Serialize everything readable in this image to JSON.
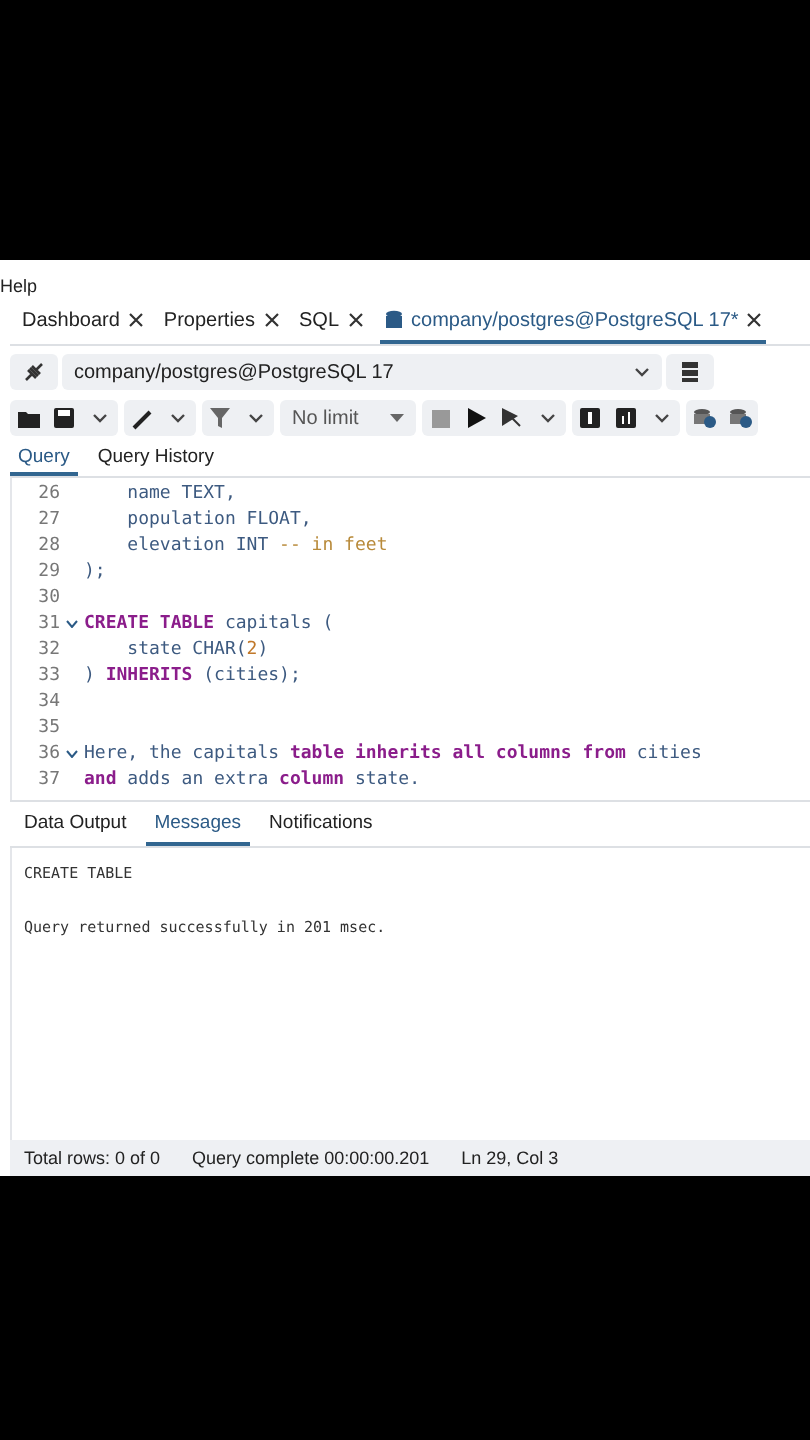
{
  "menu": {
    "items": [
      "Help"
    ]
  },
  "tabs": [
    {
      "label": "Dashboard",
      "selected": false
    },
    {
      "label": "Properties",
      "selected": false
    },
    {
      "label": "SQL",
      "selected": false
    },
    {
      "label": "company/postgres@PostgreSQL 17*",
      "selected": true,
      "kind": "database"
    }
  ],
  "connection": {
    "value": "company/postgres@PostgreSQL 17"
  },
  "toolbar": {
    "limit": "No limit"
  },
  "editor_tabs": [
    {
      "label": "Query",
      "selected": true
    },
    {
      "label": "Query History",
      "selected": false
    }
  ],
  "code_lines": [
    {
      "number": "26",
      "fold": false,
      "tokens": [
        {
          "kind": "plain",
          "text": "    name "
        },
        {
          "kind": "type",
          "text": "TEXT,"
        }
      ]
    },
    {
      "number": "27",
      "fold": false,
      "tokens": [
        {
          "kind": "plain",
          "text": "    population "
        },
        {
          "kind": "type",
          "text": "FLOAT,"
        }
      ]
    },
    {
      "number": "28",
      "fold": false,
      "tokens": [
        {
          "kind": "plain",
          "text": "    elevation "
        },
        {
          "kind": "type",
          "text": "INT "
        },
        {
          "kind": "comment",
          "text": "-- in feet"
        }
      ]
    },
    {
      "number": "29",
      "fold": false,
      "tokens": [
        {
          "kind": "plain",
          "text": ");"
        }
      ]
    },
    {
      "number": "30",
      "fold": false
    },
    {
      "number": "31",
      "fold": true,
      "tokens": [
        {
          "kind": "keyword",
          "text": "CREATE TABLE"
        },
        {
          "kind": "plain",
          "text": " capitals ("
        }
      ]
    },
    {
      "number": "32",
      "fold": false,
      "tokens": [
        {
          "kind": "plain",
          "text": "    state CHAR("
        },
        {
          "kind": "number",
          "text": "2"
        },
        {
          "kind": "plain",
          "text": ")"
        }
      ]
    },
    {
      "number": "33",
      "fold": false,
      "tokens": [
        {
          "kind": "plain",
          "text": ") "
        },
        {
          "kind": "keyword",
          "text": "INHERITS"
        },
        {
          "kind": "plain",
          "text": " (cities);"
        }
      ]
    },
    {
      "number": "34",
      "fold": false
    },
    {
      "number": "35",
      "fold": false
    },
    {
      "number": "36",
      "fold": true,
      "tokens": [
        {
          "kind": "plain",
          "text": "Here, the capitals "
        },
        {
          "kind": "keyword",
          "text": "table inherits all columns from"
        },
        {
          "kind": "plain",
          "text": " cities"
        }
      ]
    },
    {
      "number": "37",
      "fold": false,
      "tokens": [
        {
          "kind": "keyword",
          "text": "and"
        },
        {
          "kind": "plain",
          "text": " adds an extra "
        },
        {
          "kind": "keyword",
          "text": "column"
        },
        {
          "kind": "plain",
          "text": " state."
        }
      ]
    }
  ],
  "result_tabs": [
    {
      "label": "Data Output",
      "selected": false
    },
    {
      "label": "Messages",
      "selected": true
    },
    {
      "label": "Notifications",
      "selected": false
    }
  ],
  "messages": [
    "CREATE TABLE",
    "Query returned successfully in 201 msec."
  ],
  "status_bar": [
    "Total rows: 0 of 0",
    "Query complete 00:00:00.201",
    "Ln 29, Col 3"
  ]
}
